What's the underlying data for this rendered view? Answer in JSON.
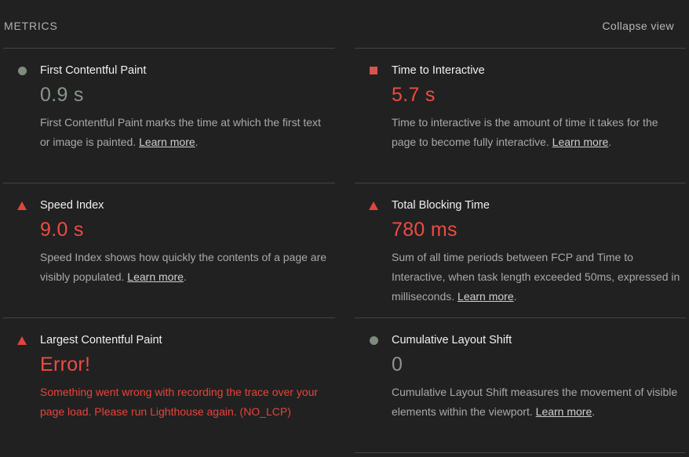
{
  "header": {
    "title": "METRICS",
    "collapse_label": "Collapse view"
  },
  "colors": {
    "pass_grey": "#8a978a",
    "fail_red": "#ef4b43",
    "average_square": "#d9534f"
  },
  "metrics": [
    {
      "name": "First Contentful Paint",
      "value": "0.9 s",
      "indicator": "circle",
      "desc": "First Contentful Paint marks the time at which the first text or image is painted.",
      "link": "Learn more"
    },
    {
      "name": "Time to Interactive",
      "value": "5.7 s",
      "indicator": "square",
      "desc": "Time to interactive is the amount of time it takes for the page to become fully interactive.",
      "link": "Learn more"
    },
    {
      "name": "Speed Index",
      "value": "9.0 s",
      "indicator": "triangle",
      "desc": "Speed Index shows how quickly the contents of a page are visibly populated.",
      "link": "Learn more"
    },
    {
      "name": "Total Blocking Time",
      "value": "780 ms",
      "indicator": "triangle",
      "desc": "Sum of all time periods between FCP and Time to Interactive, when task length exceeded 50ms, expressed in milliseconds.",
      "link": "Learn more"
    },
    {
      "name": "Largest Contentful Paint",
      "value": "Error!",
      "indicator": "triangle",
      "desc": "Something went wrong with recording the trace over your page load. Please run Lighthouse again. (NO_LCP)"
    },
    {
      "name": "Cumulative Layout Shift",
      "value": "0",
      "indicator": "circle",
      "desc": "Cumulative Layout Shift measures the movement of visible elements within the viewport.",
      "link": "Learn more"
    }
  ],
  "period": "."
}
